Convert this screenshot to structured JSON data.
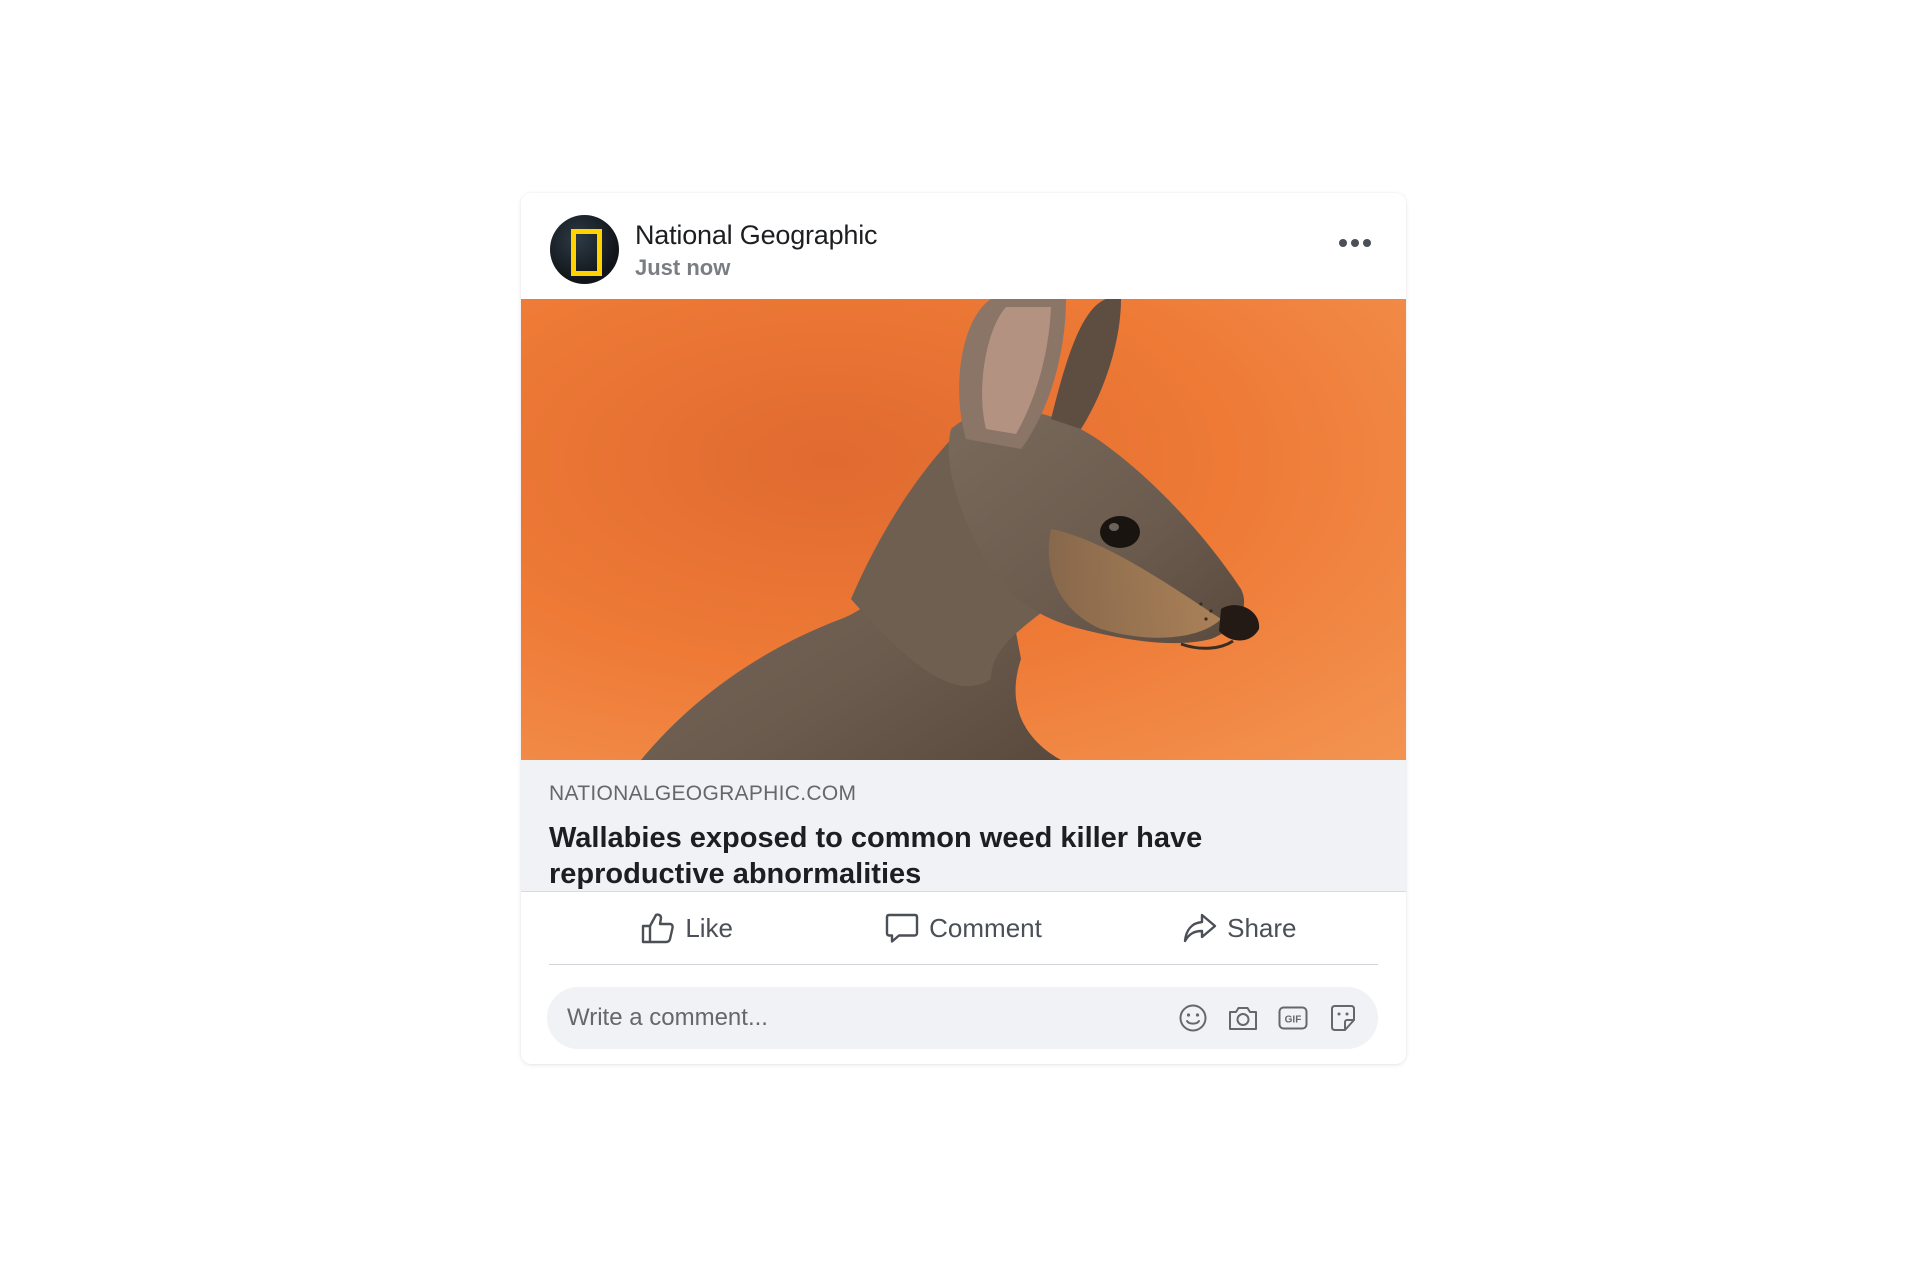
{
  "post": {
    "author": "National Geographic",
    "time": "Just now",
    "more_icon": "more-horizontal-icon"
  },
  "image": {
    "subject": "wallaby"
  },
  "link": {
    "domain": "NATIONALGEOGRAPHIC.COM",
    "title": "Wallabies exposed to common weed killer have reproductive abnormalities"
  },
  "actions": {
    "like": "Like",
    "comment": "Comment",
    "share": "Share"
  },
  "comment_box": {
    "placeholder": "Write a comment...",
    "tools": [
      "emoji-icon",
      "camera-icon",
      "gif-icon",
      "sticker-icon"
    ]
  },
  "colors": {
    "brand_yellow": "#ffd200",
    "preview_bg": "#f0f2f5",
    "image_orange": "#ee7a36",
    "text_secondary": "#65676b"
  }
}
